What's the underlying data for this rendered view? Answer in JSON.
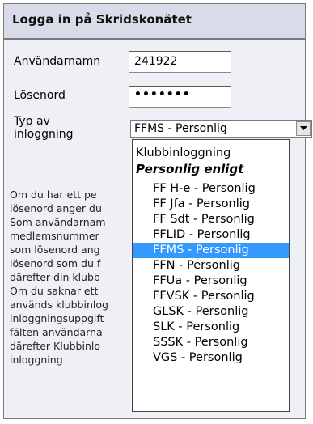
{
  "panel": {
    "title": "Logga in på Skridskonätet"
  },
  "form": {
    "username_label": "Användarnamn",
    "username_value": "241922",
    "password_label": "Lösenord",
    "password_value": "•••••••",
    "login_type_label": "Typ av inloggning",
    "login_type_selected": "FFMS - Personlig"
  },
  "dropdown": {
    "first_option": "Klubbinloggning",
    "group_label": "Personlig enligt",
    "options": [
      "FF H-e - Personlig",
      "FF Jfa - Personlig",
      "FF Sdt - Personlig",
      "FFLID - Personlig",
      "FFMS - Personlig",
      "FFN - Personlig",
      "FFUa - Personlig",
      "FFVSK - Personlig",
      "GLSK - Personlig",
      "SLK - Personlig",
      "SSSK - Personlig",
      "VGS - Personlig"
    ],
    "selected_index": 4
  },
  "help_text": [
    "Om du har ett pe",
    "lösenord anger du",
    "Som användarnam",
    "medlemsnummer",
    "som lösenord ang",
    "lösenord som du f",
    "därefter din klubb",
    "Om du saknar ett",
    "används klubbinlog",
    "inloggningsuppgift",
    "fälten användarna",
    "därefter Klubbinlo",
    "inloggning"
  ],
  "colors": {
    "header_bg": "#d9dbe8",
    "panel_bg": "#eef0f6",
    "selection": "#3399ff"
  }
}
